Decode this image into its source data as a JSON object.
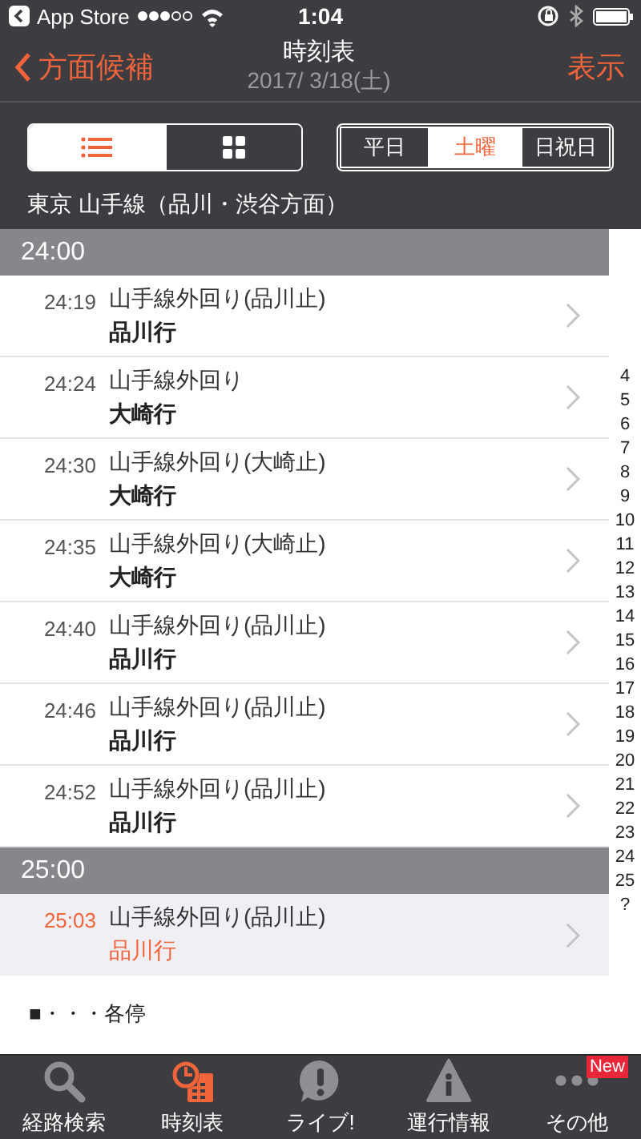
{
  "status_bar": {
    "back_label": "App Store",
    "time": "1:04"
  },
  "nav": {
    "back": "方面候補",
    "title": "時刻表",
    "date": "2017/ 3/18(土)",
    "action": "表示"
  },
  "view_toggle": [
    {
      "kind": "list",
      "selected": true
    },
    {
      "kind": "grid",
      "selected": false
    }
  ],
  "day_tabs": [
    {
      "label": "平日",
      "selected": false
    },
    {
      "label": "土曜",
      "selected": true
    },
    {
      "label": "日祝日",
      "selected": false
    }
  ],
  "route": "東京 山手線（品川・渋谷方面）",
  "sections": [
    {
      "hour": "24:00",
      "trains": [
        {
          "time": "24:19",
          "line": "山手線外回り(品川止)",
          "destination": "品川行",
          "selected": false
        },
        {
          "time": "24:24",
          "line": "山手線外回り",
          "destination": "大崎行",
          "selected": false
        },
        {
          "time": "24:30",
          "line": "山手線外回り(大崎止)",
          "destination": "大崎行",
          "selected": false
        },
        {
          "time": "24:35",
          "line": "山手線外回り(大崎止)",
          "destination": "大崎行",
          "selected": false
        },
        {
          "time": "24:40",
          "line": "山手線外回り(品川止)",
          "destination": "品川行",
          "selected": false
        },
        {
          "time": "24:46",
          "line": "山手線外回り(品川止)",
          "destination": "品川行",
          "selected": false
        },
        {
          "time": "24:52",
          "line": "山手線外回り(品川止)",
          "destination": "品川行",
          "selected": false
        }
      ]
    },
    {
      "hour": "25:00",
      "trains": [
        {
          "time": "25:03",
          "line": "山手線外回り(品川止)",
          "destination": "品川行",
          "selected": true
        }
      ]
    }
  ],
  "index": [
    "4",
    "5",
    "6",
    "7",
    "8",
    "9",
    "10",
    "11",
    "12",
    "13",
    "14",
    "15",
    "16",
    "17",
    "18",
    "19",
    "20",
    "21",
    "22",
    "23",
    "24",
    "25",
    "?"
  ],
  "legend": "■・・・各停",
  "tabs": [
    {
      "kind": "search",
      "label": "経路検索",
      "selected": false
    },
    {
      "kind": "timetable",
      "label": "時刻表",
      "selected": true
    },
    {
      "kind": "live",
      "label": "ライブ!",
      "selected": false
    },
    {
      "kind": "info",
      "label": "運行情報",
      "selected": false
    },
    {
      "kind": "more",
      "label": "その他",
      "selected": false,
      "badge": "New"
    }
  ]
}
